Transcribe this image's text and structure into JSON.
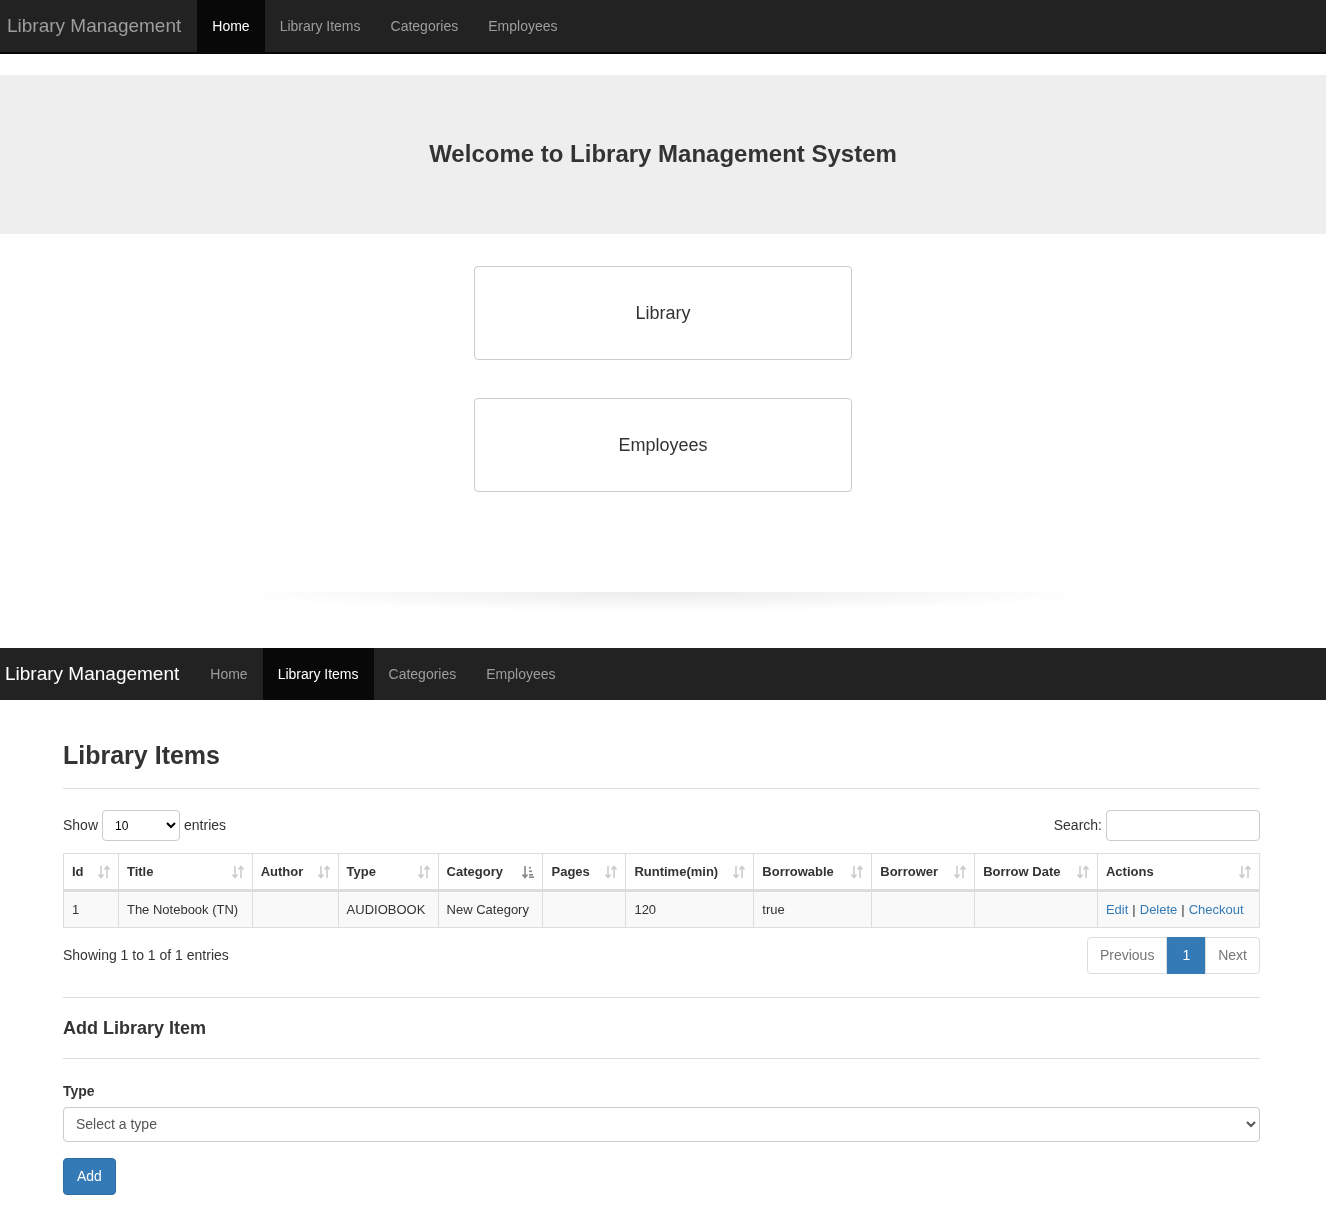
{
  "screens": [
    {
      "navbar": {
        "brand": "Library Management",
        "items": [
          {
            "label": "Home",
            "selected": true
          },
          {
            "label": "Library Items",
            "selected": false
          },
          {
            "label": "Categories",
            "selected": false
          },
          {
            "label": "Employees",
            "selected": false
          }
        ]
      },
      "jumbotron": {
        "title": "Welcome to Library Management System"
      },
      "buttons": [
        "Library",
        "Employees"
      ]
    },
    {
      "navbar": {
        "brand": "Library Management",
        "items": [
          {
            "label": "Home",
            "selected": false
          },
          {
            "label": "Library Items",
            "selected": true
          },
          {
            "label": "Categories",
            "selected": false
          },
          {
            "label": "Employees",
            "selected": false
          }
        ]
      },
      "page_title": "Library Items",
      "length_control": {
        "before": "Show",
        "value": "10",
        "after": "entries"
      },
      "search": {
        "label": "Search:"
      },
      "table": {
        "columns": [
          {
            "label": "Id",
            "sorted": false
          },
          {
            "label": "Title",
            "sorted": false
          },
          {
            "label": "Author",
            "sorted": false
          },
          {
            "label": "Type",
            "sorted": false
          },
          {
            "label": "Category",
            "sorted": true
          },
          {
            "label": "Pages",
            "sorted": false
          },
          {
            "label": "Runtime(min)",
            "sorted": false
          },
          {
            "label": "Borrowable",
            "sorted": false
          },
          {
            "label": "Borrower",
            "sorted": false
          },
          {
            "label": "Borrow Date",
            "sorted": false
          },
          {
            "label": "Actions",
            "sorted": false
          }
        ],
        "rows": [
          {
            "cells": [
              "1",
              "The Notebook (TN)",
              "",
              "AUDIOBOOK",
              "New Category",
              "",
              "120",
              "true",
              "",
              ""
            ],
            "actions": [
              "Edit",
              "Delete",
              "Checkout"
            ],
            "separator": "|"
          }
        ]
      },
      "info": "Showing 1 to 1 of 1 entries",
      "pagination": [
        {
          "label": "Previous",
          "selected": false
        },
        {
          "label": "1",
          "selected": true
        },
        {
          "label": "Next",
          "selected": false
        }
      ],
      "form": {
        "title": "Add Library Item",
        "field_label": "Type",
        "select_value": "Select a type",
        "submit": "Add"
      }
    }
  ]
}
